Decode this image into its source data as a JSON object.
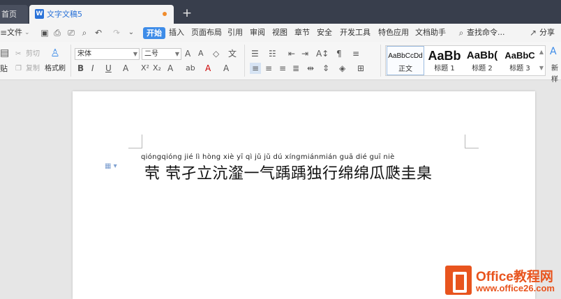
{
  "tabs": {
    "home": "首页",
    "doc_title": "文字文稿5",
    "doc_icon": "W",
    "add": "+"
  },
  "menu": {
    "file": "文件",
    "items": [
      "开始",
      "插入",
      "页面布局",
      "引用",
      "审阅",
      "视图",
      "章节",
      "安全",
      "开发工具",
      "特色应用",
      "文档助手"
    ],
    "search": "查找命令...",
    "share": "分享"
  },
  "ribbon": {
    "paste": "贴",
    "cut": "剪切",
    "copy": "复制",
    "format_painter": "格式刷",
    "font_name": "宋体",
    "font_size": "二号",
    "new_style": "新样"
  },
  "styles": [
    {
      "preview": "AaBbCcDd",
      "name": "正文"
    },
    {
      "preview": "AaBb",
      "name": "标题 1"
    },
    {
      "preview": "AaBb(",
      "name": "标题 2"
    },
    {
      "preview": "AaBbC",
      "name": "标题 3"
    }
  ],
  "document": {
    "pinyin": "qióngqióng jié  lì  hòng xiè  yī   qì   jǔ   jǔ   dú  xíngmiánmián guā  dié  guī  niè",
    "hanzi": "茕 茕孑立沆瀣一气踽踽独行绵绵瓜瓞圭臬"
  },
  "watermark": {
    "brand": "Office教程网",
    "url": "www.office26.com"
  },
  "colors": {
    "accent": "#3e8ce8",
    "titlebar": "#383e4c",
    "watermark": "#e8541e"
  }
}
